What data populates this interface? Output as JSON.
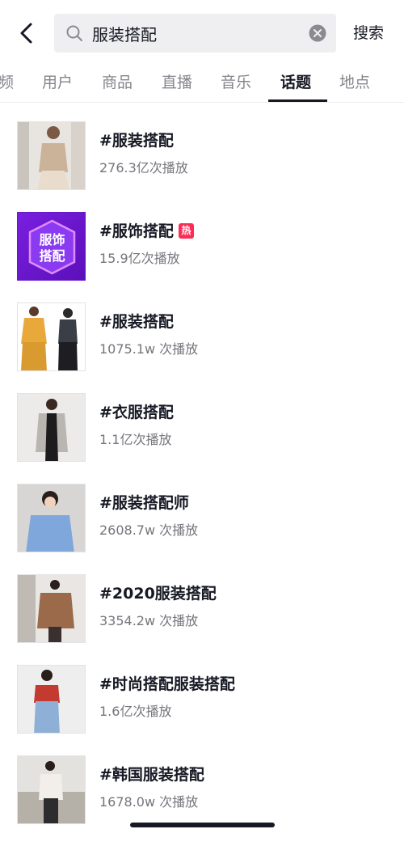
{
  "search": {
    "query": "服装搭配",
    "button_label": "搜索"
  },
  "tabs": [
    {
      "label": "频",
      "active": false
    },
    {
      "label": "用户",
      "active": false
    },
    {
      "label": "商品",
      "active": false
    },
    {
      "label": "直播",
      "active": false
    },
    {
      "label": "音乐",
      "active": false
    },
    {
      "label": "话题",
      "active": true
    },
    {
      "label": "地点",
      "active": false
    }
  ],
  "topics": [
    {
      "title": "#服装搭配",
      "views": "276.3亿次播放",
      "hot": false
    },
    {
      "title": "#服饰搭配",
      "views": "15.9亿次播放",
      "hot": true,
      "hot_label": "热",
      "thumb_text_1": "服饰",
      "thumb_text_2": "搭配"
    },
    {
      "title": "#服装搭配",
      "views": "1075.1w 次播放",
      "hot": false
    },
    {
      "title": "#衣服搭配",
      "views": "1.1亿次播放",
      "hot": false
    },
    {
      "title": "#服装搭配师",
      "views": "2608.7w 次播放",
      "hot": false
    },
    {
      "title": "#2020服装搭配",
      "views": "3354.2w 次播放",
      "hot": false
    },
    {
      "title": "#时尚搭配服装搭配",
      "views": "1.6亿次播放",
      "hot": false
    },
    {
      "title": "#韩国服装搭配",
      "views": "1678.0w 次播放",
      "hot": false
    }
  ],
  "colors": {
    "accent": "#fe2c55",
    "text": "#161823",
    "muted": "#75767c"
  },
  "icons": {
    "back": "chevron-left-icon",
    "search": "search-icon",
    "clear": "clear-icon"
  }
}
